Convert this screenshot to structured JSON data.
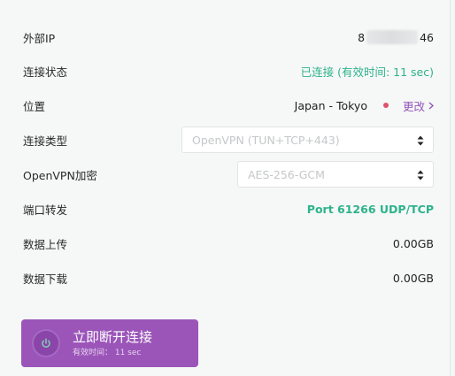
{
  "external_ip": {
    "label": "外部IP",
    "value_prefix": "8",
    "value_suffix": "46"
  },
  "connection_status": {
    "label": "连接状态",
    "value": "已连接 (有效时间: 11 sec)"
  },
  "location": {
    "label": "位置",
    "value": "Japan - Tokyo",
    "change_label": "更改"
  },
  "connection_type": {
    "label": "连接类型",
    "selected": "OpenVPN (TUN+TCP+443)"
  },
  "openvpn_encryption": {
    "label": "OpenVPN加密",
    "selected": "AES-256-GCM"
  },
  "port_forwarding": {
    "label": "端口转发",
    "value": "Port 61266 UDP/TCP"
  },
  "data_upload": {
    "label": "数据上传",
    "value": "0.00GB"
  },
  "data_download": {
    "label": "数据下载",
    "value": "0.00GB"
  },
  "disconnect_button": {
    "title": "立即断开连接",
    "subtitle": "有效时间： 11 sec",
    "icon": "power-icon"
  },
  "colors": {
    "accent_purple": "#9b55b9",
    "status_green": "#2db38a",
    "location_dot": "#e0526c"
  }
}
